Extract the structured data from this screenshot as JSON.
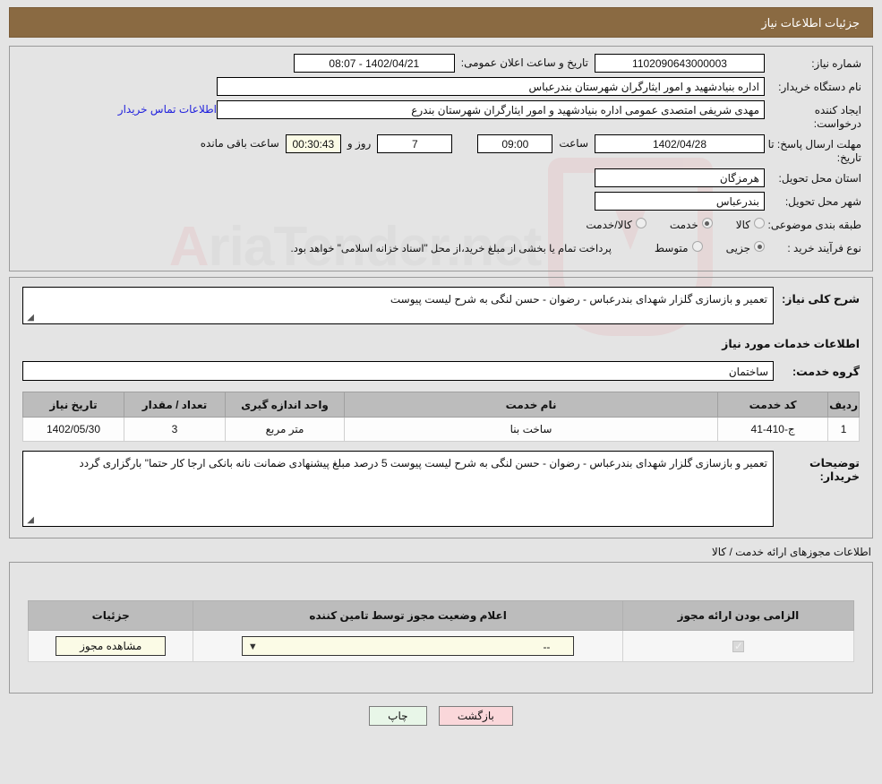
{
  "header": {
    "title": "جزئیات اطلاعات نیاز"
  },
  "form": {
    "need_number_label": "شماره نیاز:",
    "need_number_value": "1102090643000003",
    "public_announce_label": "تاریخ و ساعت اعلان عمومی:",
    "public_announce_value": "1402/04/21 - 08:07",
    "buyer_org_label": "نام دستگاه خریدار:",
    "buyer_org_value": "اداره بنیادشهید و امور ایثارگران شهرستان بندرعباس",
    "requester_label": "ایجاد کننده درخواست:",
    "requester_value": "مهدی شریفی امتصدی عمومی  اداره بنیادشهید و امور ایثارگران شهرستان بندرع",
    "contact_link": "اطلاعات تماس خریدار",
    "deadline_label": "مهلت ارسال پاسخ: تا تاریخ:",
    "deadline_date": "1402/04/28",
    "deadline_hour_label": "ساعت",
    "deadline_time": "09:00",
    "remaining_days": "7",
    "days_and_label": "روز و",
    "remaining_time": "00:30:43",
    "remaining_suffix": "ساعت باقی مانده",
    "province_label": "استان محل تحویل:",
    "province_value": "هرمزگان",
    "city_label": "شهر محل تحویل:",
    "city_value": "بندرعباس",
    "category_label": "طبقه بندی موضوعی:",
    "category_options": [
      {
        "label": "کالا",
        "selected": false
      },
      {
        "label": "خدمت",
        "selected": true
      },
      {
        "label": "کالا/خدمت",
        "selected": false
      }
    ],
    "process_label": "نوع فرآیند خرید :",
    "process_options": [
      {
        "label": "جزیی",
        "selected": true
      },
      {
        "label": "متوسط",
        "selected": false
      }
    ],
    "process_note": "پرداخت تمام یا بخشی از مبلغ خرید،از محل \"اسناد خزانه اسلامی\" خواهد بود."
  },
  "details": {
    "summary_label": "شرح کلی نیاز:",
    "summary_value": "تعمیر و بازسازی گلزار شهدای بندرعباس - رضوان - حسن لنگی به شرح لیست پیوست",
    "services_section_title": "اطلاعات خدمات مورد نیاز",
    "service_group_label": "گروه خدمت:",
    "service_group_value": "ساختمان",
    "buyer_notes_label": "توضیحات خریدار:",
    "buyer_notes_value": "تعمیر و بازسازی گلزار شهدای بندرعباس - رضوان - حسن لنگی به شرح لیست پیوست 5 درصد مبلغ پیشنهادی ضمانت نانه بانکی ارجا کار حتما\" بارگزاری گردد"
  },
  "services_table": {
    "columns": [
      "ردیف",
      "کد خدمت",
      "نام خدمت",
      "واحد اندازه گیری",
      "تعداد / مقدار",
      "تاریخ نیاز"
    ],
    "rows": [
      [
        "1",
        "ج-410-41",
        "ساخت بنا",
        "متر مربع",
        "3",
        "1402/05/30"
      ]
    ]
  },
  "permits": {
    "outside_label": "اطلاعات مجوزهای ارائه خدمت / کالا",
    "columns": [
      "الزامی بودن ارائه مجوز",
      "اعلام وضعیت مجوز توسط تامین کننده",
      "جزئیات"
    ],
    "rows": [
      {
        "required": true,
        "status_value": "--",
        "detail_button": "مشاهده مجوز"
      }
    ]
  },
  "footer": {
    "print_label": "چاپ",
    "back_label": "بازگشت"
  },
  "colors": {
    "header_bg": "#8a6a42",
    "link": "#2222dd",
    "print_btn": "#e8f6e8",
    "back_btn": "#fad7da",
    "table_header": "#bcbcbc",
    "highlight_field": "#fbfbe6"
  }
}
